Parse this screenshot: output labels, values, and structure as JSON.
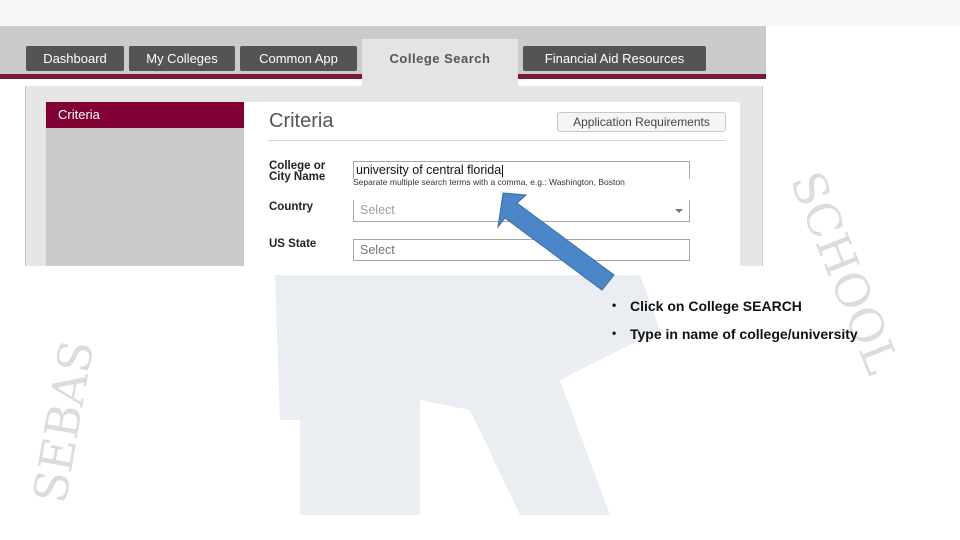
{
  "watermark": {
    "left_text": "SEBAS",
    "right_text": "SCHOOL",
    "emblem_letter": "R"
  },
  "nav": {
    "tabs": [
      {
        "label": "Dashboard",
        "active": false
      },
      {
        "label": "My Colleges",
        "active": false
      },
      {
        "label": "Common App",
        "active": false
      },
      {
        "label": "College Search",
        "active": true
      },
      {
        "label": "Financial Aid Resources",
        "active": false
      }
    ],
    "accent_color": "#7a1a35"
  },
  "sidebar": {
    "header": "Criteria",
    "header_color": "#800034"
  },
  "criteria": {
    "title": "Criteria",
    "app_requirements_button": "Application Requirements",
    "fields": {
      "college": {
        "label_line1": "College or",
        "label_line2": "City Name",
        "value": "university of central florida",
        "hint": "Separate multiple search terms with a comma, e.g.: Washington, Boston"
      },
      "country": {
        "label": "Country",
        "placeholder": "Select"
      },
      "state": {
        "label": "US State",
        "placeholder": "Select"
      }
    }
  },
  "annotation": {
    "arrow_color": "#4a86c8",
    "bullets": [
      "Click on College SEARCH",
      "Type in name of college/university"
    ]
  }
}
